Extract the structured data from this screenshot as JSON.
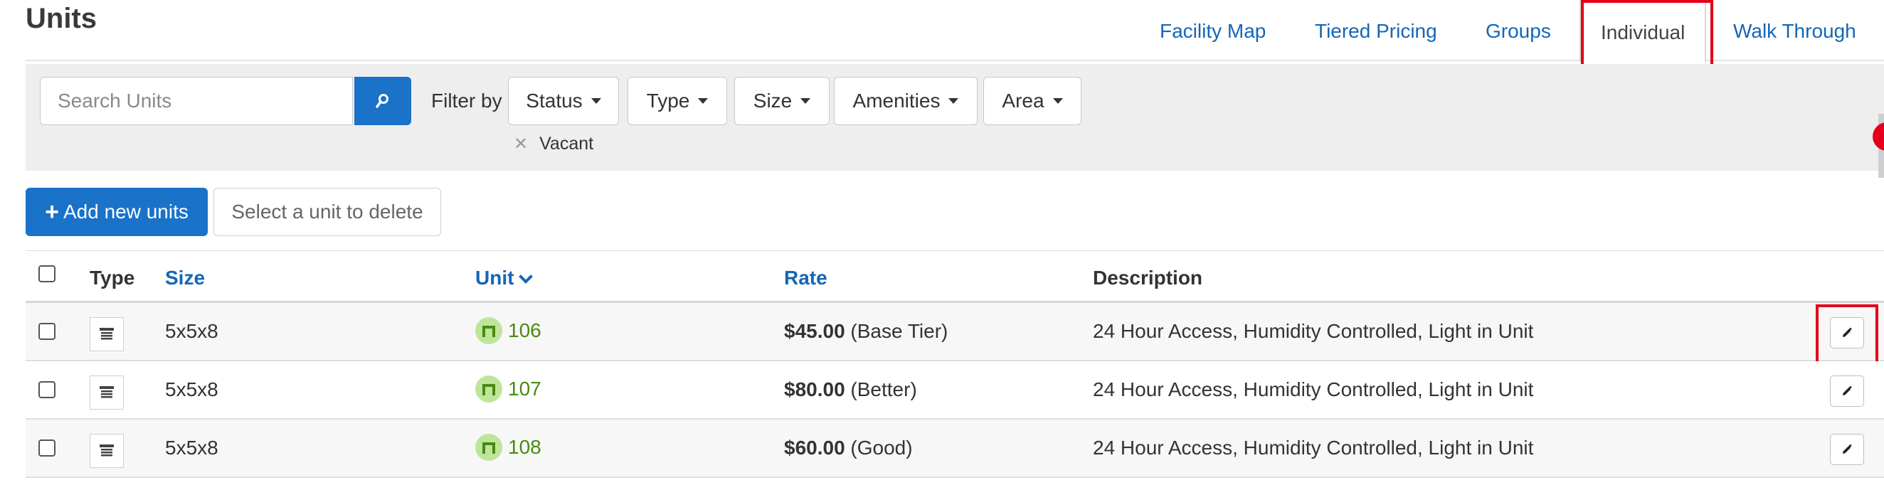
{
  "page": {
    "title": "Units"
  },
  "tabs": [
    {
      "label": "Facility Map",
      "active": false
    },
    {
      "label": "Tiered Pricing",
      "active": false
    },
    {
      "label": "Groups",
      "active": false
    },
    {
      "label": "Individual",
      "active": true
    },
    {
      "label": "Walk Through",
      "active": false
    }
  ],
  "filters": {
    "search_placeholder": "Search Units",
    "filter_by_label": "Filter by",
    "dropdowns": [
      "Status",
      "Type",
      "Size",
      "Amenities",
      "Area"
    ],
    "active_chips": [
      "Vacant"
    ]
  },
  "actions": {
    "add_label": "Add new units",
    "delete_label": "Select a unit to delete"
  },
  "table": {
    "headers": {
      "type": "Type",
      "size": "Size",
      "unit": "Unit",
      "rate": "Rate",
      "description": "Description"
    },
    "rows": [
      {
        "size": "5x5x8",
        "unit": "106",
        "rate": "$45.00",
        "tier": "(Base Tier)",
        "description": "24 Hour Access, Humidity Controlled, Light in Unit"
      },
      {
        "size": "5x5x8",
        "unit": "107",
        "rate": "$80.00",
        "tier": "(Better)",
        "description": "24 Hour Access, Humidity Controlled, Light in Unit"
      },
      {
        "size": "5x5x8",
        "unit": "108",
        "rate": "$60.00",
        "tier": "(Good)",
        "description": "24 Hour Access, Humidity Controlled, Light in Unit"
      }
    ]
  },
  "colors": {
    "primary": "#1a72c9",
    "link": "#1466b8",
    "highlight": "#e3001b",
    "unit_green": "#4a8a12",
    "unit_badge": "#bfe59a"
  },
  "icons": {
    "search": "search-icon",
    "plus": "plus-icon",
    "unit_type": "storage-unit-icon",
    "unit_badge": "unit-door-icon",
    "edit": "pencil-icon",
    "sort": "chevron-down-icon"
  }
}
